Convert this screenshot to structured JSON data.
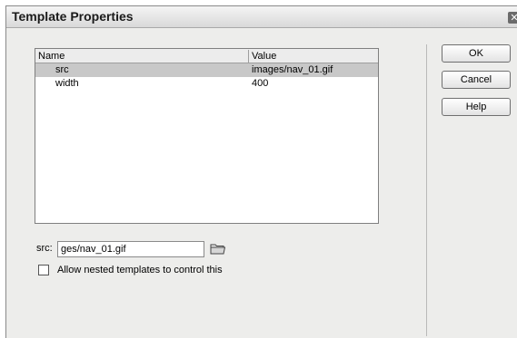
{
  "window": {
    "title": "Template Properties",
    "close_glyph": "✕"
  },
  "table": {
    "columns": [
      "Name",
      "Value"
    ],
    "rows": [
      {
        "name": "src",
        "value": "images/nav_01.gif",
        "selected": true
      },
      {
        "name": "width",
        "value": "400",
        "selected": false
      }
    ]
  },
  "field": {
    "label": "src:",
    "value": "ges/nav_01.gif",
    "browse_icon": "folder-icon"
  },
  "checkbox": {
    "label": "Allow nested templates to control this",
    "checked": false
  },
  "buttons": {
    "ok": "OK",
    "cancel": "Cancel",
    "help": "Help"
  },
  "colors": {
    "selected_row": "#c8c8c8",
    "dialog_bg": "#ededeb"
  }
}
